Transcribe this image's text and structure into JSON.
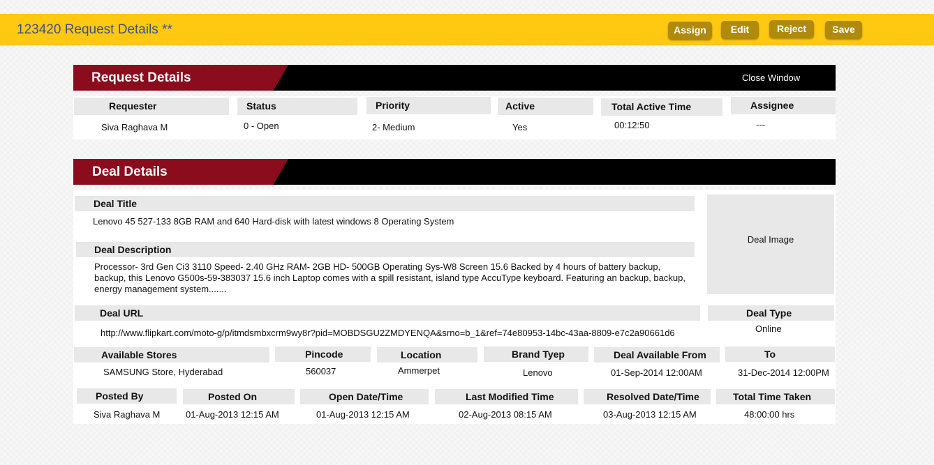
{
  "header": {
    "title": "123420 Request Details **",
    "buttons": {
      "assign": "Assign",
      "edit": "Edit",
      "reject": "Reject",
      "save": "Save"
    }
  },
  "request": {
    "section_title": "Request Details",
    "close_label": "Close Window",
    "labels": {
      "requester": "Requester",
      "status": "Status",
      "priority": "Priority",
      "active": "Active",
      "total_active_time": "Total Active Time",
      "assignee": "Assignee"
    },
    "values": {
      "requester": "Siva Raghava M",
      "status": "0 - Open",
      "priority": "2- Medium",
      "active": "Yes",
      "total_active_time": "00:12:50",
      "assignee": "---"
    }
  },
  "deal": {
    "section_title": "Deal Details",
    "labels": {
      "title": "Deal Title",
      "description": "Deal Description",
      "url": "Deal URL",
      "type": "Deal Type",
      "image": "Deal Image",
      "stores": "Available Stores",
      "pincode": "Pincode",
      "location": "Location",
      "brand": "Brand Tyep",
      "available_from": "Deal Available From",
      "to": "To",
      "posted_by": "Posted By",
      "posted_on": "Posted On",
      "open_datetime": "Open Date/Time",
      "last_modified": "Last Modified Time",
      "resolved": "Resolved Date/Time",
      "total_time": "Total Time Taken"
    },
    "values": {
      "title": "Lenovo 45 527-133 8GB RAM and 640 Hard-disk with latest windows 8 Operating System",
      "description": "Processor- 3rd Gen Ci3 3110 Speed- 2.40 GHz RAM- 2GB HD- 500GB Operating Sys-W8 Screen 15.6 Backed by 4 hours of battery backup, backup, this Lenovo G500s-59-383037 15.6 inch Laptop comes with a spill resistant, island type AccuType keyboard. Featuring an backup, backup, energy management system.......",
      "url": "http://www.flipkart.com/moto-g/p/itmdsmbxcrm9wy8r?pid=MOBDSGU2ZMDYENQA&srno=b_1&ref=74e80953-14bc-43aa-8809-e7c2a90661d6",
      "type": "Online",
      "stores": "SAMSUNG Store, Hyderabad",
      "pincode": "560037",
      "location": "Ammerpet",
      "brand": "Lenovo",
      "available_from": "01-Sep-2014 12:00AM",
      "to": "31-Dec-2014 12:00PM",
      "posted_by": "Siva Raghava M",
      "posted_on": "01-Aug-2013 12:15 AM",
      "open_datetime": "01-Aug-2013 12:15 AM",
      "last_modified": "02-Aug-2013 08:15 AM",
      "resolved": "03-Aug-2013 12:15 AM",
      "total_time": "48:00:00 hrs"
    }
  }
}
